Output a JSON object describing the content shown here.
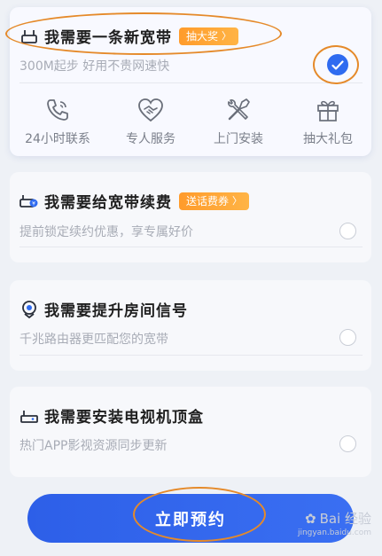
{
  "options": [
    {
      "title": "我需要一条新宽带",
      "badge": "抽大奖",
      "subtitle": "300M起步 好用不贵网速快",
      "selected": true
    },
    {
      "title": "我需要给宽带续费",
      "badge": "送话费券",
      "subtitle": "提前锁定续约优惠，享专属好价",
      "selected": false
    },
    {
      "title": "我需要提升房间信号",
      "subtitle": "千兆路由器更匹配您的宽带",
      "selected": false
    },
    {
      "title": "我需要安装电视机顶盒",
      "subtitle": "热门APP影视资源同步更新",
      "selected": false
    }
  ],
  "features": [
    {
      "label": "24小时联系",
      "icon": "phone-icon"
    },
    {
      "label": "专人服务",
      "icon": "handshake-heart-icon"
    },
    {
      "label": "上门安装",
      "icon": "tools-icon"
    },
    {
      "label": "抽大礼包",
      "icon": "gift-icon"
    }
  ],
  "cta": {
    "label": "立即预约"
  },
  "watermark": {
    "text": "Bai 经验",
    "sub": "jingyan.baidu.com"
  },
  "colors": {
    "accent": "#2f6bf0",
    "badge": "#ff9f2e",
    "annotation": "#e58a2a"
  }
}
